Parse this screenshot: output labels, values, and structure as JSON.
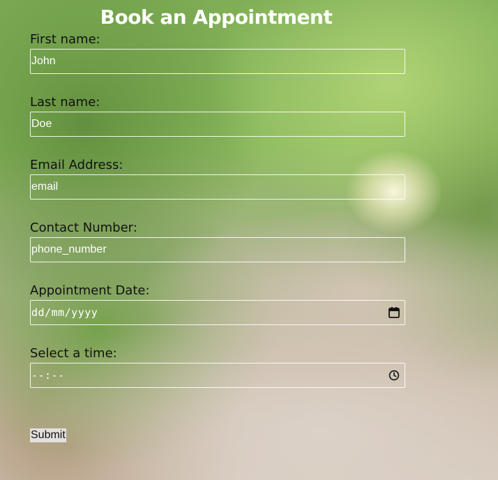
{
  "form": {
    "title": "Book an Appointment",
    "fields": [
      {
        "label": "First name:",
        "value": "John"
      },
      {
        "label": "Last name:",
        "value": "Doe"
      },
      {
        "label": "Email Address:",
        "value": "email"
      },
      {
        "label": "Contact Number:",
        "value": "phone_number"
      },
      {
        "label": "Appointment Date:",
        "value": "dd/mm/yyyy",
        "icon": "calendar-icon"
      },
      {
        "label": "Select a time:",
        "value": "--:--",
        "icon": "clock-icon"
      }
    ],
    "submit_label": "Submit"
  }
}
